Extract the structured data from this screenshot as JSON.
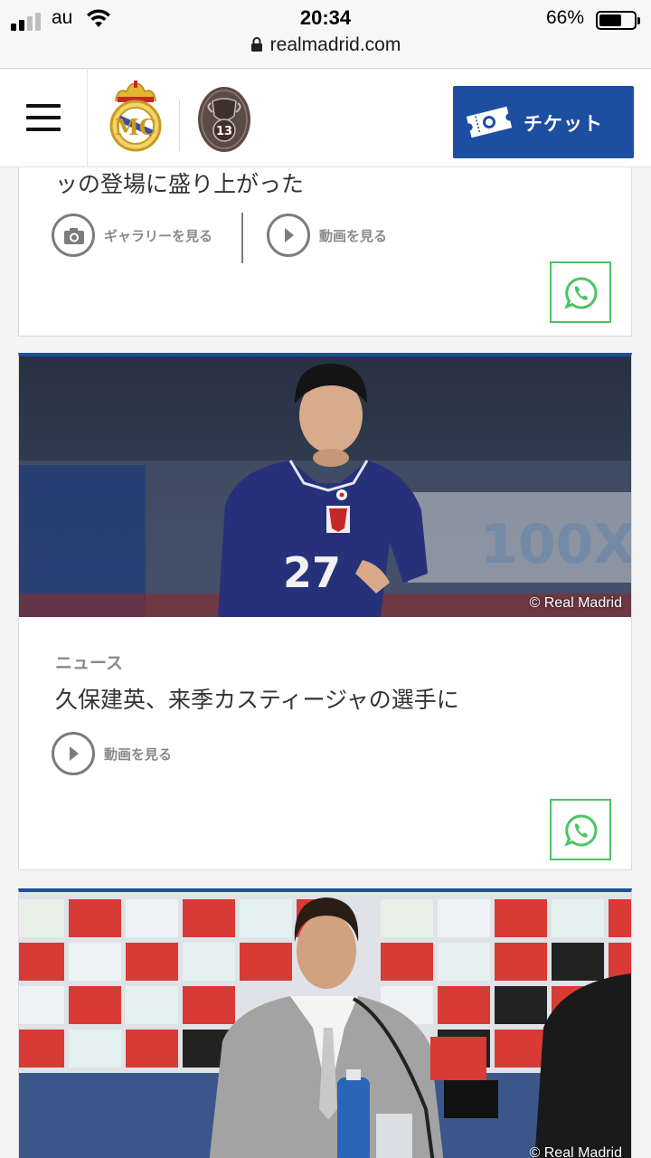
{
  "status_bar": {
    "carrier": "au",
    "time": "20:34",
    "battery_percent": "66%",
    "battery_level": 0.66,
    "url": "realmadrid.com"
  },
  "header": {
    "ticket_label": "チケット"
  },
  "cards": [
    {
      "title_partial": "ッの登場に盛り上がった",
      "gallery_label": "ギャラリーを見る",
      "video_label": "動画を見る"
    },
    {
      "photo_credit": "© Real Madrid",
      "category": "ニュース",
      "headline": "久保建英、来季カスティージャの選手に",
      "video_label": "動画を見る"
    },
    {
      "photo_credit": "© Real Madrid"
    }
  ],
  "colors": {
    "brand_blue": "#1c4fa0",
    "whatsapp_green": "#4cc463"
  },
  "icons": [
    "menu-icon",
    "real-madrid-crest",
    "ucl-13-badge",
    "ticket-icon",
    "camera-icon",
    "play-icon",
    "whatsapp-icon",
    "lock-icon",
    "wifi-icon",
    "signal-icon",
    "battery-icon"
  ]
}
